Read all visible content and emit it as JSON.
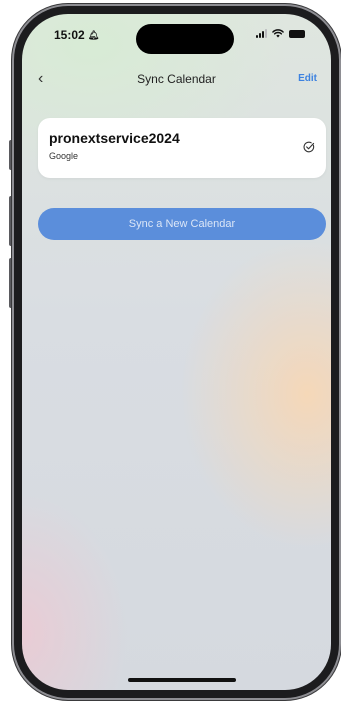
{
  "status_bar": {
    "time": "15:02",
    "icons": [
      "bell-icon",
      "signal-icon",
      "wifi-icon",
      "battery-icon"
    ]
  },
  "nav": {
    "back_icon": "chevron-left-icon",
    "title": "Sync Calendar",
    "edit_label": "Edit"
  },
  "calendars": [
    {
      "name": "pronextservice2024",
      "provider": "Google",
      "status_icon": "check-circle-icon"
    }
  ],
  "actions": {
    "sync_new_label": "Sync a New Calendar"
  },
  "colors": {
    "accent": "#3d82e0",
    "button_fill": "#5b8edb",
    "card_bg": "#ffffff"
  }
}
